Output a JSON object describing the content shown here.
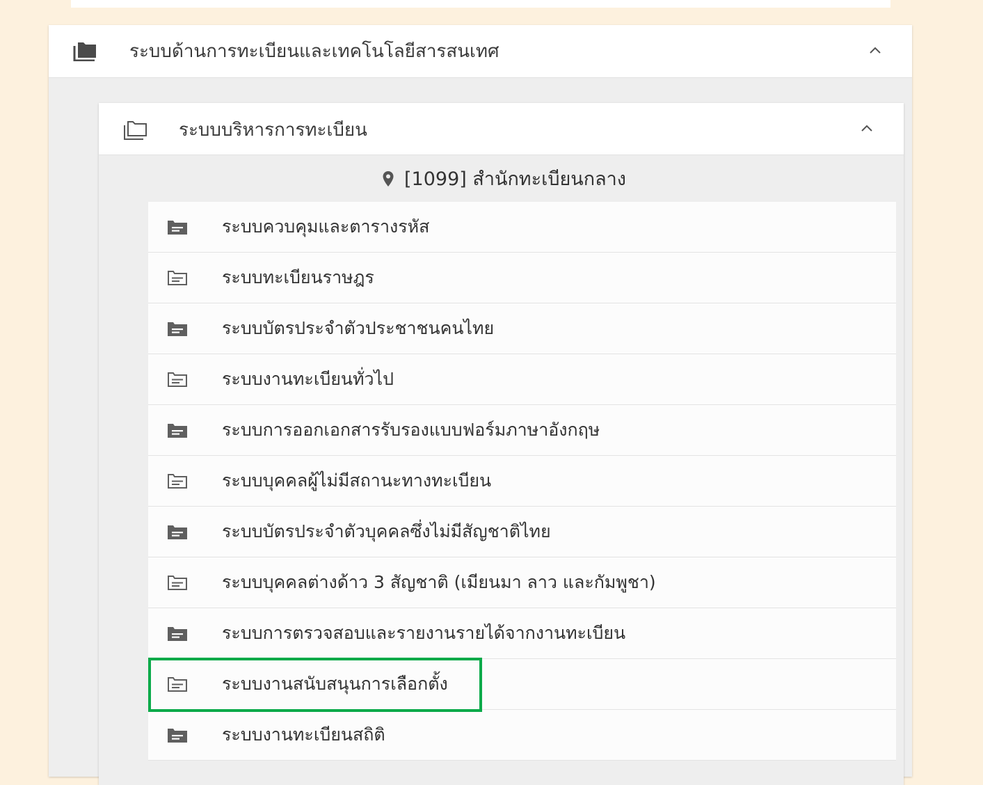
{
  "outer_section": {
    "title": "ระบบด้านการทะเบียนและเทคโนโลยีสารสนเทศ",
    "icon": "folder-filled-icon",
    "state_icon": "chevron-up-icon"
  },
  "inner_section": {
    "title": "ระบบบริหารการทะเบียน",
    "icon": "folder-outline-icon",
    "state_icon": "chevron-up-icon"
  },
  "location": {
    "icon": "map-pin-icon",
    "label": "[1099] สำนักทะเบียนกลาง"
  },
  "items": [
    {
      "label": "ระบบควบคุมและตารางรหัส",
      "icon": "folder-filled-icon"
    },
    {
      "label": "ระบบทะเบียนราษฎร",
      "icon": "folder-outline-icon"
    },
    {
      "label": "ระบบบัตรประจำตัวประชาชนคนไทย",
      "icon": "folder-filled-icon"
    },
    {
      "label": "ระบบงานทะเบียนทั่วไป",
      "icon": "folder-outline-icon"
    },
    {
      "label": "ระบบการออกเอกสารรับรองแบบฟอร์มภาษาอังกฤษ",
      "icon": "folder-filled-icon"
    },
    {
      "label": "ระบบบุคคลผู้ไม่มีสถานะทางทะเบียน",
      "icon": "folder-outline-icon"
    },
    {
      "label": "ระบบบัตรประจำตัวบุคคลซึ่งไม่มีสัญชาติไทย",
      "icon": "folder-filled-icon"
    },
    {
      "label": "ระบบบุคคลต่างด้าว 3 สัญชาติ (เมียนมา ลาว และกัมพูชา)",
      "icon": "folder-outline-icon"
    },
    {
      "label": "ระบบการตรวจสอบและรายงานรายได้จากงานทะเบียน",
      "icon": "folder-filled-icon"
    },
    {
      "label": "ระบบงานสนับสนุนการเลือกตั้ง",
      "icon": "folder-outline-icon",
      "highlighted": true
    },
    {
      "label": "ระบบงานทะเบียนสถิติ",
      "icon": "folder-filled-icon"
    }
  ],
  "colors": {
    "page_background": "#fdf1de",
    "panel_background": "#eeeeee",
    "row_background": "#fcfcfc",
    "highlight": "#0aaa4a",
    "icon": "#5f5f5f"
  }
}
